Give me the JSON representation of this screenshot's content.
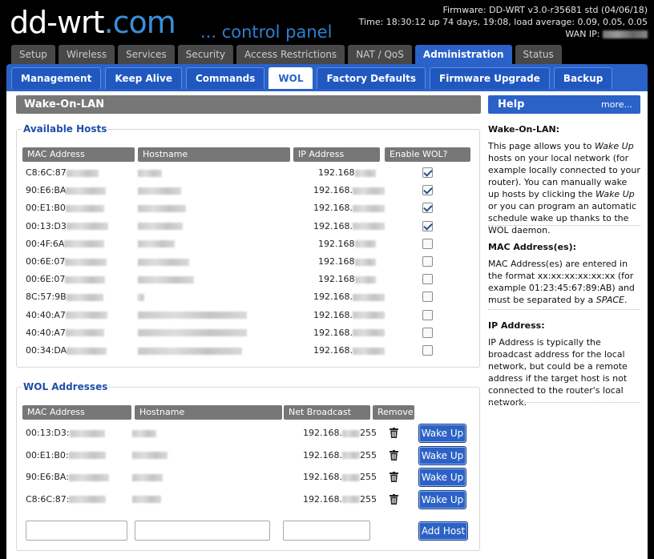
{
  "header": {
    "logo_main": "dd-wrt",
    "logo_suffix": ".com",
    "tagline": "... control panel",
    "firmware": "Firmware: DD-WRT v3.0-r35681 std (04/06/18)",
    "time": "Time: 18:30:12 up 74 days, 19:08, load average: 0.09, 0.05, 0.05",
    "wan_label": "WAN IP:"
  },
  "main_tabs": [
    "Setup",
    "Wireless",
    "Services",
    "Security",
    "Access Restrictions",
    "NAT / QoS",
    "Administration",
    "Status"
  ],
  "active_main_tab": "Administration",
  "sub_tabs": [
    "Management",
    "Keep Alive",
    "Commands",
    "WOL",
    "Factory Defaults",
    "Firmware Upgrade",
    "Backup"
  ],
  "active_sub_tab": "WOL",
  "page_title": "Wake-On-LAN",
  "available_hosts": {
    "legend": "Available Hosts",
    "headers": [
      "MAC Address",
      "Hostname",
      "IP Address",
      "Enable WOL?"
    ],
    "rows": [
      {
        "mac": "C8:6C:87",
        "ip": "192.168",
        "checked": true
      },
      {
        "mac": "90:E6:BA",
        "ip": "192.168.",
        "checked": true
      },
      {
        "mac": "00:E1:B0",
        "ip": "192.168.",
        "checked": true
      },
      {
        "mac": "00:13:D3",
        "ip": "192.168.",
        "checked": true
      },
      {
        "mac": "00:4F:6A",
        "ip": "192.168",
        "checked": false
      },
      {
        "mac": "00:6E:07",
        "ip": "192.168",
        "checked": false
      },
      {
        "mac": "00:6E:07",
        "ip": "192.168",
        "checked": false
      },
      {
        "mac": "8C:57:9B",
        "ip": "192.168.",
        "checked": false
      },
      {
        "mac": "40:40:A7",
        "ip": "192.168.",
        "checked": false
      },
      {
        "mac": "40:40:A7",
        "ip": "192.168.",
        "checked": false
      },
      {
        "mac": "00:34:DA",
        "ip": "192.168.",
        "checked": false
      }
    ]
  },
  "wol_addresses": {
    "legend": "WOL Addresses",
    "headers": [
      "MAC Address",
      "Hostname",
      "Net Broadcast",
      "Remove"
    ],
    "rows": [
      {
        "mac": "00:13:D3:",
        "bcast_a": "192.168.",
        "bcast_b": "255",
        "button": "Wake Up"
      },
      {
        "mac": "00:E1:B0:",
        "bcast_a": "192.168.",
        "bcast_b": "255",
        "button": "Wake Up"
      },
      {
        "mac": "90:E6:BA:",
        "bcast_a": "192.168.",
        "bcast_b": "255",
        "button": "Wake Up"
      },
      {
        "mac": "C8:6C:87:",
        "bcast_a": "192.168.",
        "bcast_b": "255",
        "button": "Wake Up"
      }
    ],
    "add_button": "Add Host",
    "inputs": {
      "mac": "",
      "hostname": "",
      "broadcast": ""
    }
  },
  "help": {
    "title": "Help",
    "more": "more...",
    "sections": [
      {
        "heading": "Wake-On-LAN:",
        "parts": [
          "This page allows you to ",
          "Wake Up",
          " hosts on your local network (for example locally connected to your router). You can manually wake up hosts by clicking the ",
          "Wake Up",
          " or you can program an automatic schedule wake up thanks to the WOL daemon."
        ]
      },
      {
        "heading": "MAC Address(es):",
        "parts": [
          "MAC Address(es) are entered in the format xx:xx:xx:xx:xx:xx (for example 01:23:45:67:89:AB) and must be separated by a ",
          "SPACE",
          "."
        ]
      },
      {
        "heading": "IP Address:",
        "parts": [
          "IP Address is typically the broadcast address for the local network, but could be a remote address if the target host is not connected to the router's local network."
        ]
      }
    ]
  },
  "colors": {
    "accent": "#2a62c8",
    "header_bg": "#000000",
    "title_gray": "#777777"
  }
}
